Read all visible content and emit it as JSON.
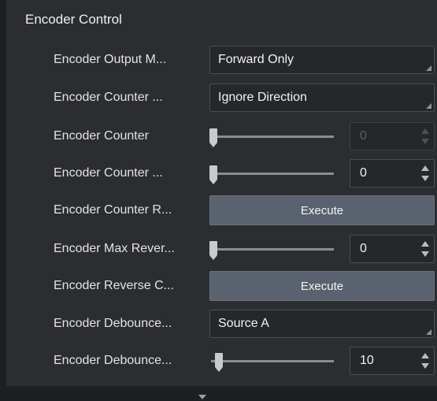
{
  "section": {
    "title": "Encoder Control"
  },
  "rows": [
    {
      "label": "Encoder Output M...",
      "type": "select",
      "value": "Forward Only"
    },
    {
      "label": "Encoder Counter ...",
      "type": "select",
      "value": "Ignore Direction"
    },
    {
      "label": "Encoder Counter",
      "type": "slider",
      "value": "0",
      "disabled": true,
      "slider_fraction": 0
    },
    {
      "label": "Encoder Counter ...",
      "type": "slider",
      "value": "0",
      "disabled": false,
      "slider_fraction": 0
    },
    {
      "label": "Encoder Counter R...",
      "type": "button",
      "button_label": "Execute"
    },
    {
      "label": "Encoder Max Rever...",
      "type": "slider",
      "value": "0",
      "disabled": false,
      "slider_fraction": 0
    },
    {
      "label": "Encoder Reverse C...",
      "type": "button",
      "button_label": "Execute"
    },
    {
      "label": "Encoder Debounce...",
      "type": "select",
      "value": "Source A"
    },
    {
      "label": "Encoder Debounce...",
      "type": "slider",
      "value": "10",
      "disabled": false,
      "slider_fraction": 0.05
    }
  ],
  "icons": {
    "spin_up": "chevron-up-icon",
    "spin_down": "chevron-down-icon",
    "more": "chevron-down-icon"
  },
  "colors": {
    "panel_bg": "#2b2d31",
    "button_bg": "#59626e",
    "text": "#e6e6e6"
  }
}
